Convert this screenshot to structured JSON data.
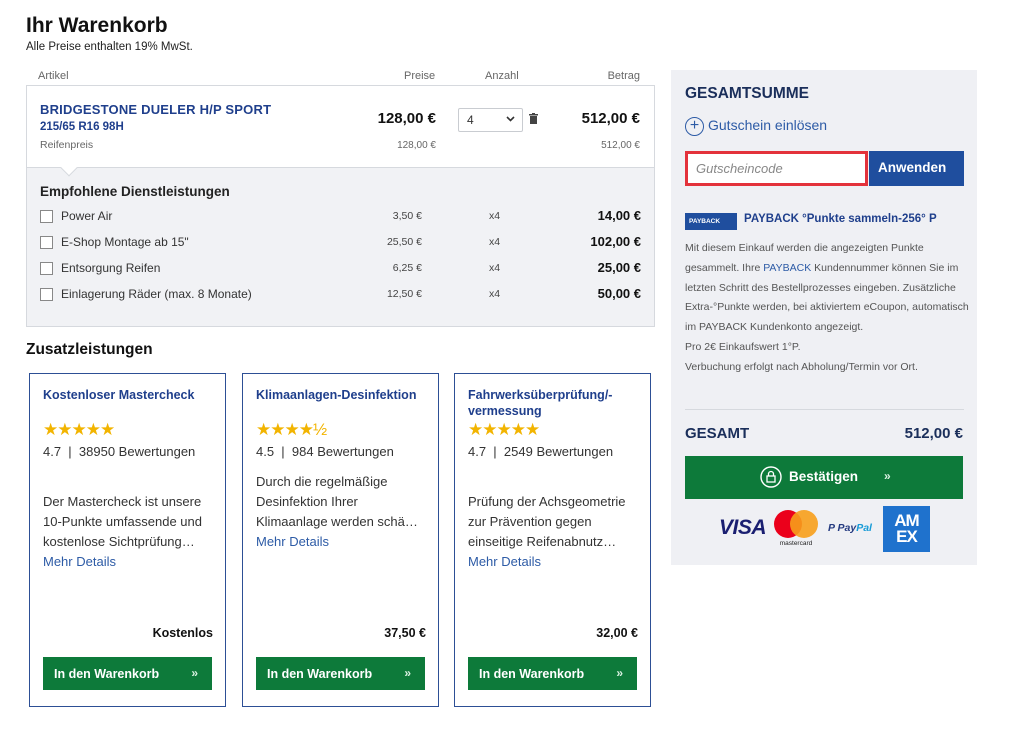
{
  "header": {
    "title": "Ihr Warenkorb",
    "vat_note": "Alle Preise enthalten 19% MwSt."
  },
  "table": {
    "col_article": "Artikel",
    "col_prices": "Preise",
    "col_qty": "Anzahl",
    "col_amount": "Betrag"
  },
  "product": {
    "name": "BRIDGESTONE DUELER H/P SPORT",
    "size": "215/65 R16 98H",
    "subtitle": "Reifenpreis",
    "unit_price": "128,00 €",
    "unit_price_sub": "128,00 €",
    "quantity": "4",
    "line_total": "512,00 €",
    "line_total_sub": "512,00 €"
  },
  "services": {
    "title": "Empfohlene Dienstleistungen",
    "items": [
      {
        "name": "Power Air",
        "price": "3,50 €",
        "qty": "x4",
        "total": "14,00 €"
      },
      {
        "name": "E-Shop Montage ab 15\"",
        "price": "25,50 €",
        "qty": "x4",
        "total": "102,00 €"
      },
      {
        "name": "Entsorgung Reifen",
        "price": "6,25 €",
        "qty": "x4",
        "total": "25,00 €"
      },
      {
        "name": "Einlagerung Räder (max. 8 Monate)",
        "price": "12,50 €",
        "qty": "x4",
        "total": "50,00 €"
      }
    ]
  },
  "extras": {
    "title": "Zusatzleistungen",
    "cards": [
      {
        "title": "Kostenloser Mastercheck",
        "stars": "★★★★★",
        "rating": "4.7",
        "reviews": "38950 Bewertungen",
        "description": "Der Mastercheck ist unsere 10-Punkte umfassende und kostenlose Sichtprüfung…",
        "more": "Mehr Details",
        "price": "Kostenlos",
        "button": "In den Warenkorb",
        "arrow": "»"
      },
      {
        "title": "Klimaanlagen-Desinfektion",
        "stars": "★★★★½",
        "rating": "4.5",
        "reviews": "984 Bewertungen",
        "description": "Durch die regelmäßige Desinfektion Ihrer Klimaanlage werden schä…",
        "more": "Mehr Details",
        "price": "37,50 €",
        "button": "In den Warenkorb",
        "arrow": "»"
      },
      {
        "title": "Fahrwerksüberprüfung/-vermessung",
        "stars": "★★★★★",
        "rating": "4.7",
        "reviews": "2549 Bewertungen",
        "description": "Prüfung der Achsgeometrie zur Prävention gegen einseitige Reifenabnutz…",
        "more": "Mehr Details",
        "price": "32,00 €",
        "button": "In den Warenkorb",
        "arrow": "»"
      }
    ]
  },
  "summary": {
    "title": "GESAMTSUMME",
    "voucher_link": "Gutschein einlösen",
    "voucher_placeholder": "Gutscheincode",
    "apply_button": "Anwenden",
    "payback_badge": "PAYBACK",
    "payback_title": "PAYBACK °Punkte sammeln-256° P",
    "payback_text_1": "Mit diesem Einkauf werden die angezeigten Punkte gesammelt. Ihre ",
    "payback_text_brand": "PAYBACK",
    "payback_text_2": " Kundennummer können Sie im letzten Schritt des Bestellprozesses eingeben. Zusätzliche Extra-°Punkte werden, bei aktiviertem eCoupon, automatisch im PAYBACK Kundenkonto angezeigt.",
    "payback_text_3": "Pro 2€ Einkaufswert 1°P.",
    "payback_text_4": "Verbuchung erfolgt nach Abholung/Termin vor Ort.",
    "total_label": "GESAMT",
    "total_value": "512,00 €",
    "confirm_button": "Bestätigen",
    "confirm_arrow": "»",
    "payment": {
      "visa": "VISA",
      "mastercard": "mastercard",
      "paypal_1": "Pay",
      "paypal_2": "Pal",
      "amex_1": "AM",
      "amex_2": "EX"
    }
  }
}
